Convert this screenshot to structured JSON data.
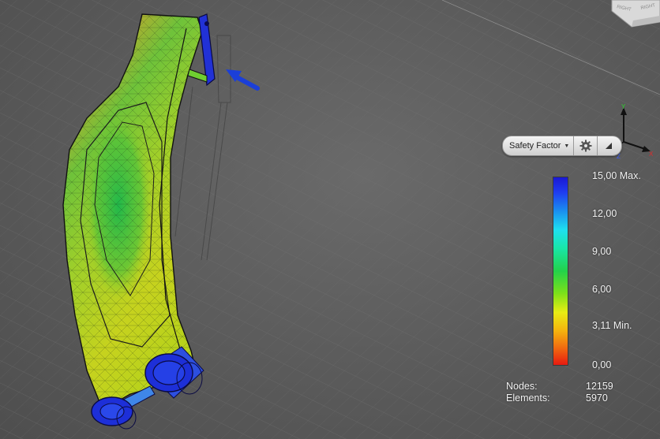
{
  "view": {
    "result_type_label": "Safety Factor",
    "icons": {
      "dropdown": "chevron-down-icon",
      "settings": "gear-icon",
      "collapse": "triangle-collapse-icon",
      "load": "arrow-icon",
      "viewcube": "viewcube-icon"
    },
    "viewcube": {
      "face_left": "RIGHT",
      "face_right": "RIGHT"
    },
    "triad": {
      "x": "X",
      "y": "Y",
      "z": "Z"
    }
  },
  "legend": {
    "max_label": "15,00 Max.",
    "ticks": [
      "12,00",
      "9,00",
      "6,00"
    ],
    "min_label": "3,11 Min.",
    "zero_label": "0,00",
    "colors": {
      "max": "#1a18d4",
      "mid": "#23d24a",
      "min": "#e81a10"
    }
  },
  "mesh_stats": {
    "nodes_label": "Nodes:",
    "nodes_value": "12159",
    "elements_label": "Elements:",
    "elements_value": "5970"
  }
}
